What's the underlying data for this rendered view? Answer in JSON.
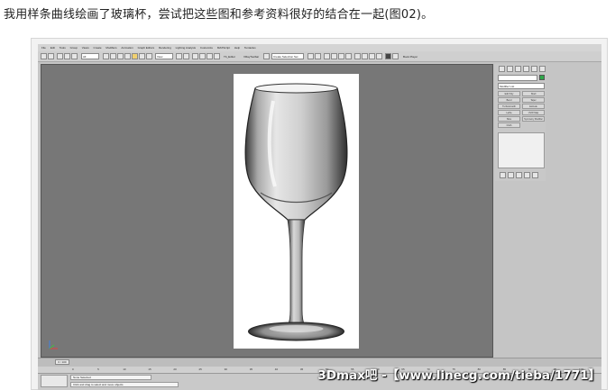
{
  "caption": "我用样条曲线绘画了玻璃杯，尝试把这些图和参考资料很好的结合在一起(图02)。",
  "menubar": {
    "items": [
      "File",
      "Edit",
      "Tools",
      "Group",
      "Views",
      "Create",
      "Modifiers",
      "Animation",
      "Graph Editors",
      "Rendering",
      "Lighting Analysis",
      "Customize",
      "MAXScript",
      "Help",
      "Tentacles"
    ]
  },
  "toolbar": {
    "selection_filter": "All",
    "view_dropdown": "View",
    "select_ment": "Create Selection Set",
    "extra_label": "Tb_Editor",
    "vray_label": "VRayToolbar",
    "book_player": "Book Player"
  },
  "command_panel": {
    "modifier_list": "Modifier List",
    "buttons": [
      "Edit Poly",
      "Shell",
      "Bend",
      "Taper",
      "Turbosmooth",
      "Extrude",
      "Lathe",
      "UVW Map",
      "Slice",
      "Symmetry Modifier",
      "Cloth"
    ]
  },
  "timeline": {
    "slider_label": "0 / 100",
    "ruler_ticks": [
      "0",
      "5",
      "10",
      "15",
      "20",
      "25",
      "30",
      "35",
      "40",
      "45",
      "50",
      "55",
      "60",
      "65",
      "70",
      "75",
      "80",
      "85",
      "90",
      "95",
      "100"
    ]
  },
  "status": {
    "selection": "None Selected",
    "prompt": "Click and drag to select and move objects"
  },
  "watermark": "3Dmax吧 -【www.linecg.com/tieba/1771】",
  "colors": {
    "viewport_bg": "#777777",
    "photo_bg": "#ffffff",
    "ui_gray": "#c5c5c5"
  },
  "photo_description_icon": "wine-glass-icon"
}
